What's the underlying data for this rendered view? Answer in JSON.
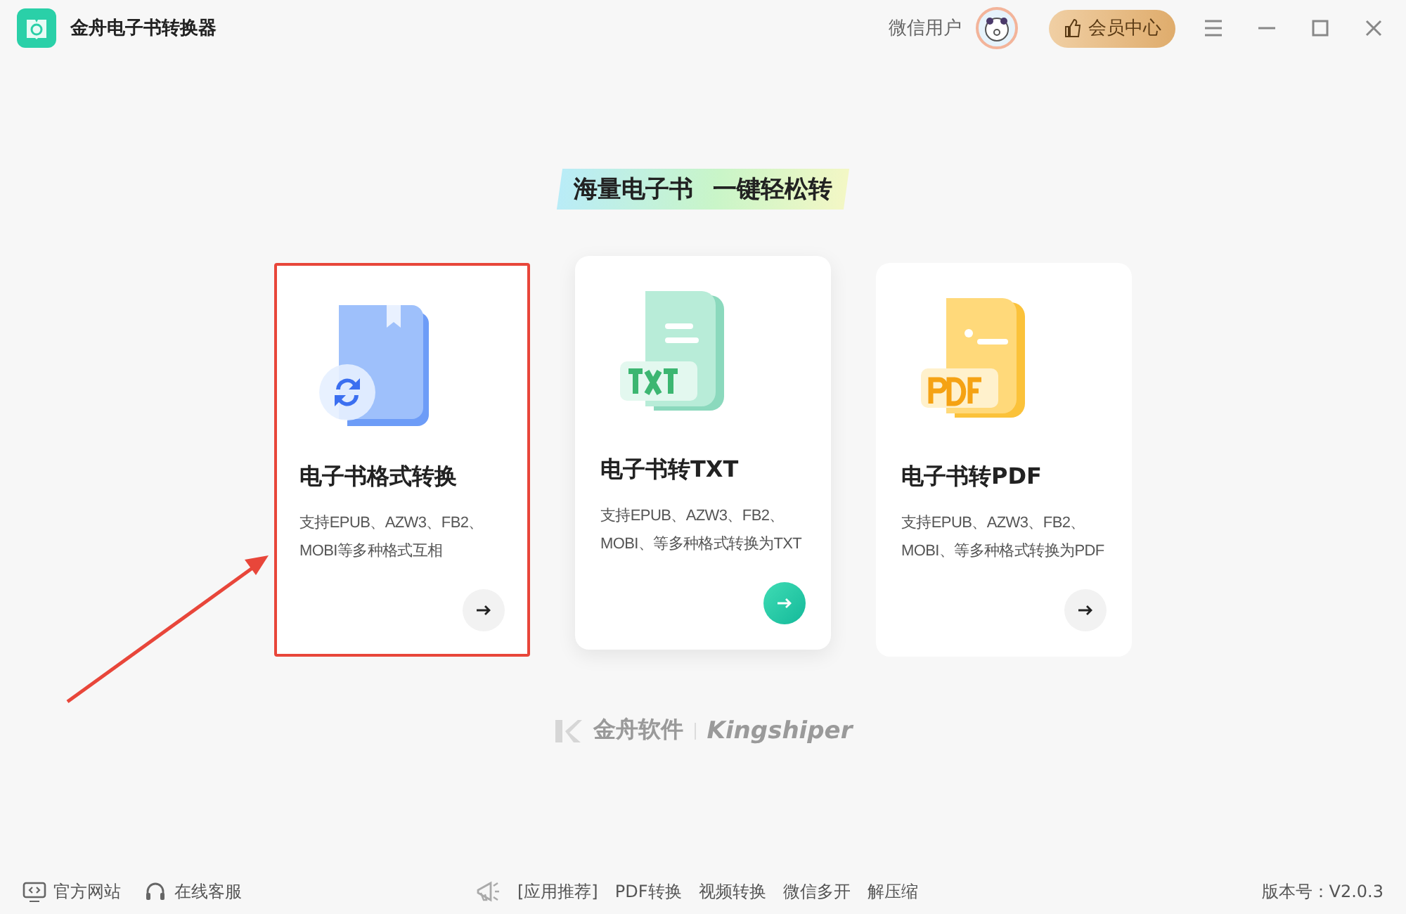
{
  "window": {
    "title": "金舟电子书转换器"
  },
  "user": {
    "name": "微信用户"
  },
  "vip_button": {
    "label": "会员中心"
  },
  "tagline": {
    "left": "海量电子书",
    "right": "一键轻松转"
  },
  "cards": [
    {
      "kind": "format",
      "title": "电子书格式转换",
      "description": "支持EPUB、AZW3、FB2、MOBI等多种格式互相",
      "hovered": false,
      "annotated": true
    },
    {
      "kind": "txt",
      "title": "电子书转TXT",
      "description": "支持EPUB、AZW3、FB2、MOBI、等多种格式转换为TXT",
      "hovered": true,
      "annotated": false
    },
    {
      "kind": "pdf",
      "title": "电子书转PDF",
      "description": "支持EPUB、AZW3、FB2、MOBI、等多种格式转换为PDF",
      "hovered": false,
      "annotated": false
    }
  ],
  "brand": {
    "cn": "金舟软件",
    "en": "Kingshiper"
  },
  "footer": {
    "left": [
      {
        "kind": "website",
        "label": "官方网站"
      },
      {
        "kind": "support",
        "label": "在线客服"
      }
    ],
    "recommend": "[应用推荐]",
    "links": [
      "PDF转换",
      "视频转换",
      "微信多开",
      "解压缩"
    ],
    "version": "版本号：V2.0.3"
  }
}
